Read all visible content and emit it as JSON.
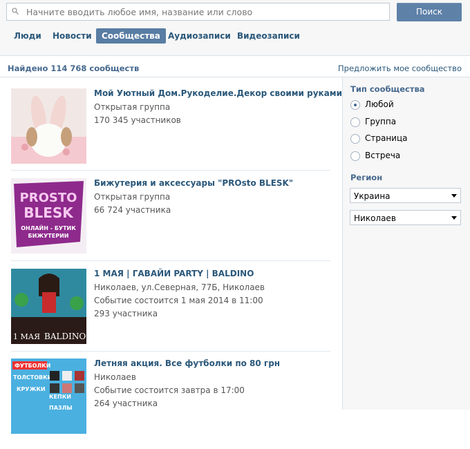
{
  "search": {
    "placeholder": "Начните вводить любое имя, название или слово",
    "button": "Поиск"
  },
  "tabs": [
    {
      "label": "Люди",
      "active": false
    },
    {
      "label": "Новости",
      "active": false
    },
    {
      "label": "Сообщества",
      "active": true
    },
    {
      "label": "Аудиозаписи",
      "active": false
    },
    {
      "label": "Видеозаписи",
      "active": false
    }
  ],
  "results": {
    "found": "Найдено 114 768 сообществ",
    "suggest": "Предложить мое сообщество"
  },
  "filters": {
    "type_title": "Тип сообщества",
    "types": [
      {
        "label": "Любой",
        "checked": true
      },
      {
        "label": "Группа",
        "checked": false
      },
      {
        "label": "Страница",
        "checked": false
      },
      {
        "label": "Встреча",
        "checked": false
      }
    ],
    "region_title": "Регион",
    "country": "Украина",
    "city": "Николаев"
  },
  "communities": [
    {
      "name": "Мой Уютный Дом.Рукоделие.Декор своими руками",
      "lines": [
        "Открытая группа",
        "170 345 участников"
      ]
    },
    {
      "name": "Бижутерия и аксессуары \"PROsto BLESK\"",
      "lines": [
        "Открытая группа",
        "66 724 участника"
      ],
      "thumb_text": [
        "PROSTO",
        "BLESK",
        "ОНЛАЙН - БУТИК",
        "БИЖУТЕРИИ"
      ]
    },
    {
      "name": "1 МАЯ | ГАВАЙИ PARTY | BALDINO",
      "lines": [
        "Николаев, ул.Северная, 77Б, Николаев",
        "Событие состоится 1 мая 2014 в 11:00",
        "293 участника"
      ],
      "thumb_text": [
        "1 МАЯ",
        "BALDINO"
      ]
    },
    {
      "name": "Летняя акция. Все футболки по 80 грн",
      "lines": [
        "Николаев",
        "Событие состоится завтра в 17:00",
        "264 участника"
      ],
      "thumb_text": [
        "ФУТБОЛКИ",
        "ТОЛСТОВКИ",
        "КРУЖКИ",
        "КЕПКИ",
        "ПАЗЛЫ"
      ]
    }
  ]
}
